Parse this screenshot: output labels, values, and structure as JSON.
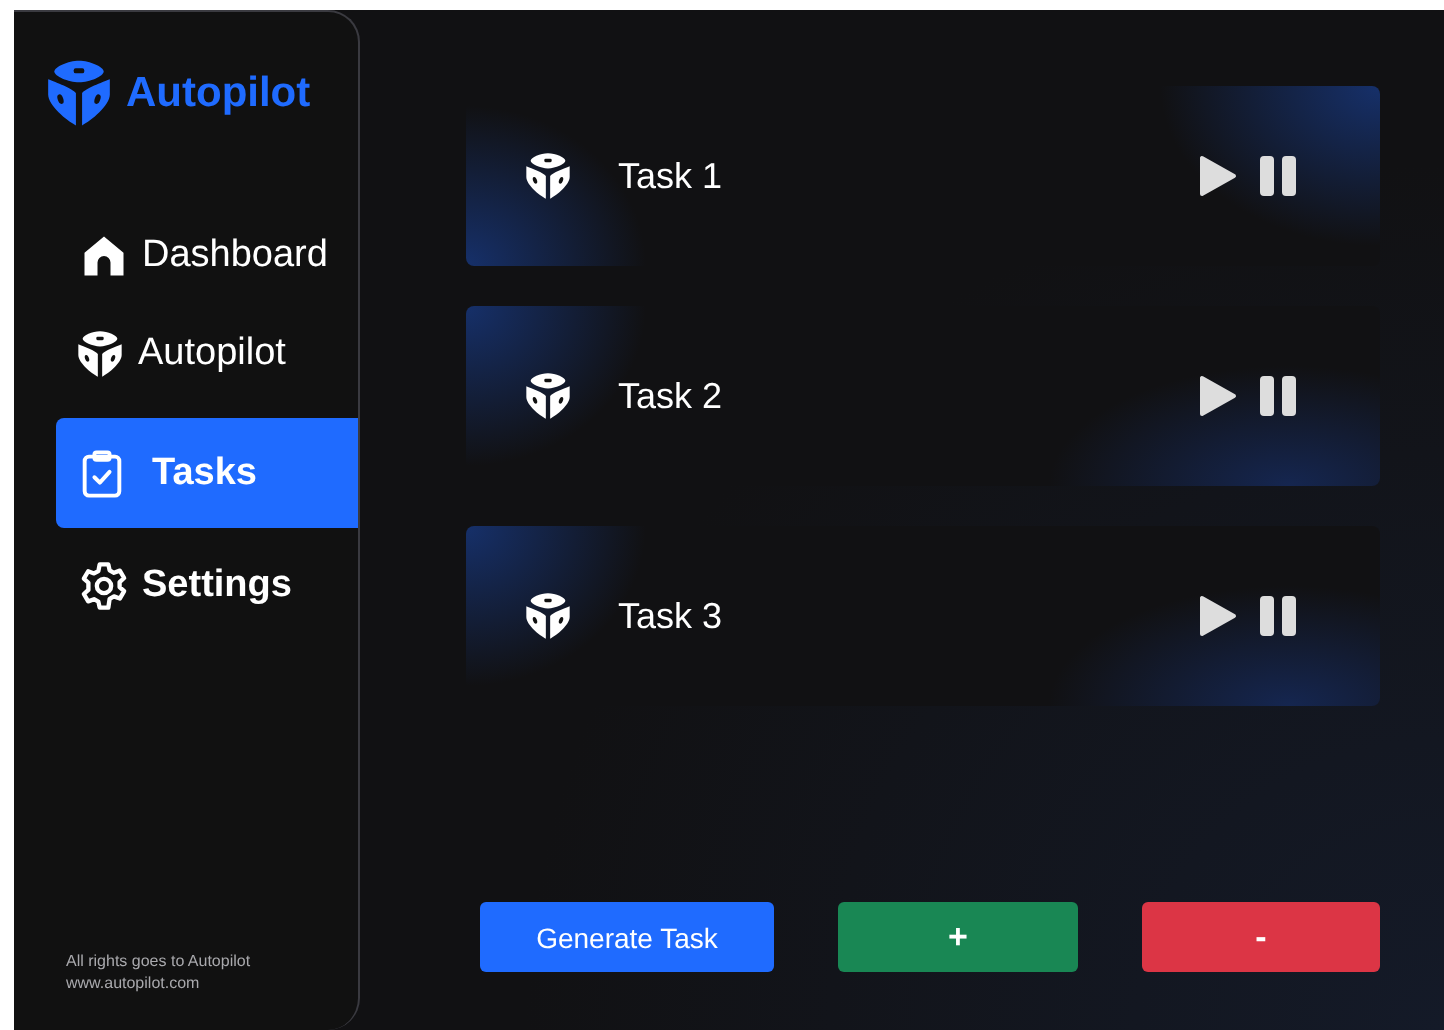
{
  "brand": {
    "name": "Autopilot"
  },
  "nav": [
    {
      "label": "Dashboard",
      "kind": "house",
      "selected": false
    },
    {
      "label": "Autopilot",
      "kind": "cube",
      "selected": false
    },
    {
      "label": "Tasks",
      "kind": "clipboard",
      "selected": true
    },
    {
      "label": "Settings",
      "kind": "gear",
      "selected": false
    }
  ],
  "footer": [
    "All rights goes to Autopilot",
    "www.autopilot.com"
  ],
  "tasks": [
    {
      "name": "Task 1"
    },
    {
      "name": "Task 2"
    },
    {
      "name": "Task 3"
    }
  ],
  "actions": [
    {
      "label": "Generate Task",
      "kind": "generate"
    },
    {
      "label": "+",
      "kind": "add"
    },
    {
      "label": "-",
      "kind": "remove"
    }
  ]
}
